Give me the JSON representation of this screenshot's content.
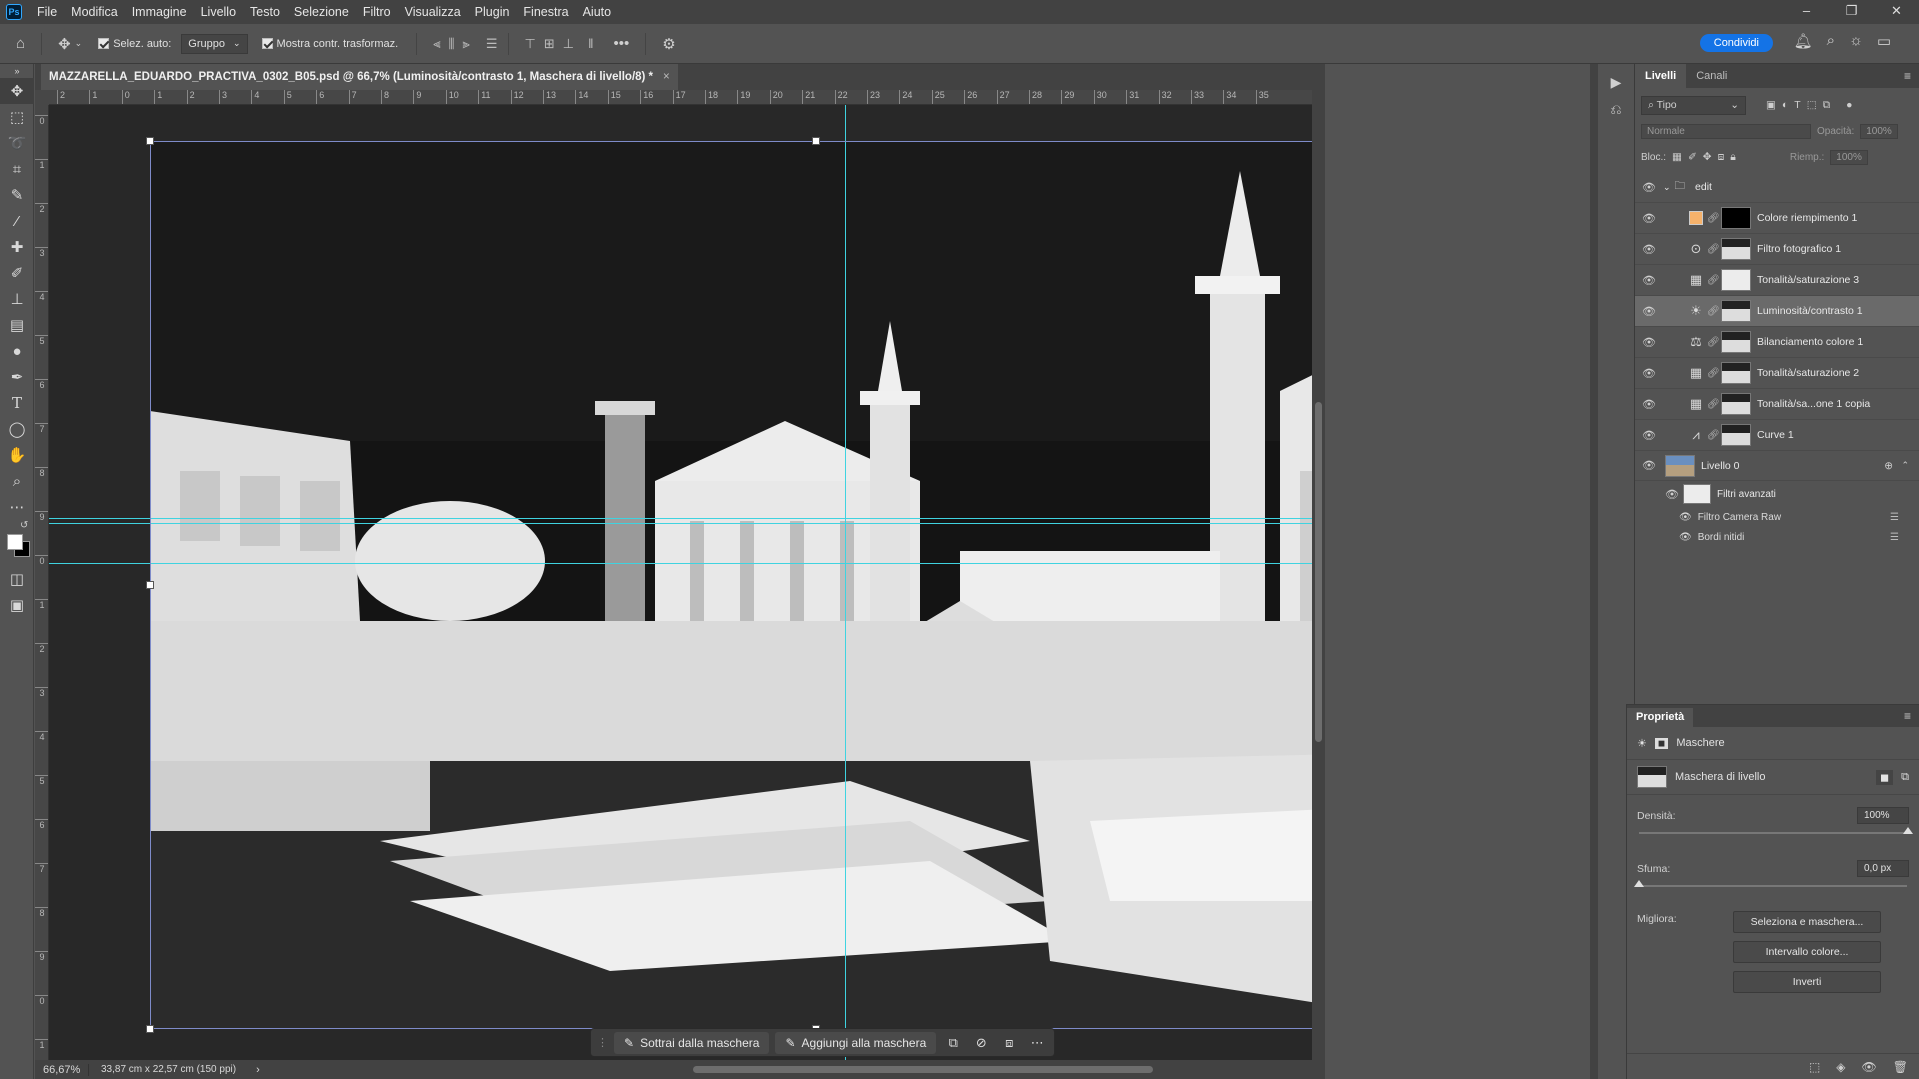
{
  "menu": {
    "items": [
      "File",
      "Modifica",
      "Immagine",
      "Livello",
      "Testo",
      "Selezione",
      "Filtro",
      "Visualizza",
      "Plugin",
      "Finestra",
      "Aiuto"
    ]
  },
  "options_bar": {
    "auto_select_label": "Selez. auto:",
    "auto_select_value": "Gruppo",
    "show_transform_label": "Mostra contr. trasformaz.",
    "share_label": "Condividi"
  },
  "document": {
    "tab_title": "MAZZARELLA_EDUARDO_PRACTIVA_0302_B05.psd @ 66,7% (Luminosità/contrasto 1, Maschera di livello/8) *",
    "ruler_h": [
      "2",
      "1",
      "0",
      "1",
      "2",
      "3",
      "4",
      "5",
      "6",
      "7",
      "8",
      "9",
      "10",
      "11",
      "12",
      "13",
      "14",
      "15",
      "16",
      "17",
      "18",
      "19",
      "20",
      "21",
      "22",
      "23",
      "24",
      "25",
      "26",
      "27",
      "28",
      "29",
      "30",
      "31",
      "32",
      "33",
      "34",
      "35"
    ],
    "ruler_v": [
      "0",
      "1",
      "2",
      "3",
      "4",
      "5",
      "6",
      "7",
      "8",
      "9",
      "0",
      "1",
      "2",
      "3",
      "4",
      "5",
      "6",
      "7",
      "8",
      "9",
      "0",
      "1"
    ]
  },
  "status": {
    "zoom": "66,67%",
    "doc_size": "33,87 cm x 22,57 cm (150 ppi)"
  },
  "task_bar": {
    "subtract_label": "Sottrai dalla maschera",
    "add_label": "Aggiungi alla maschera"
  },
  "layers_panel": {
    "tabs": [
      "Livelli",
      "Canali"
    ],
    "filter_label": "Tipo",
    "blend_mode": "Normale",
    "opacity_label": "Opacità:",
    "opacity_value": "100%",
    "lock_label": "Bloc.:",
    "fill_label": "Riemp.:",
    "fill_value": "100%",
    "group_name": "edit",
    "layers": [
      {
        "name": "Colore riempimento 1",
        "thumb": "black",
        "selected": false
      },
      {
        "name": "Filtro fotografico 1",
        "thumb": "mask",
        "selected": false
      },
      {
        "name": "Tonalità/saturazione 3",
        "thumb": "white",
        "selected": false
      },
      {
        "name": "Luminosità/contrasto 1",
        "thumb": "mask",
        "selected": true
      },
      {
        "name": "Bilanciamento colore 1",
        "thumb": "mask",
        "selected": false
      },
      {
        "name": "Tonalità/saturazione 2",
        "thumb": "mask",
        "selected": false
      },
      {
        "name": "Tonalità/sa...one 1 copia",
        "thumb": "mask",
        "selected": false
      },
      {
        "name": "Curve 1",
        "thumb": "mask",
        "selected": false
      }
    ],
    "base_layer": "Livello 0",
    "smart_filters_label": "Filtri avanzati",
    "smart_filters": [
      "Filtro Camera Raw",
      "Bordi nitidi"
    ]
  },
  "properties_panel": {
    "title": "Proprietà",
    "section": "Maschere",
    "mask_name": "Maschera di livello",
    "density_label": "Densità:",
    "density_value": "100%",
    "density_fraction": 1.0,
    "feather_label": "Sfuma:",
    "feather_value": "0,0 px",
    "feather_fraction": 0.0,
    "refine_label": "Migliora:",
    "btn_select_mask": "Seleziona e maschera...",
    "btn_color_range": "Intervallo colore...",
    "btn_invert": "Inverti"
  }
}
